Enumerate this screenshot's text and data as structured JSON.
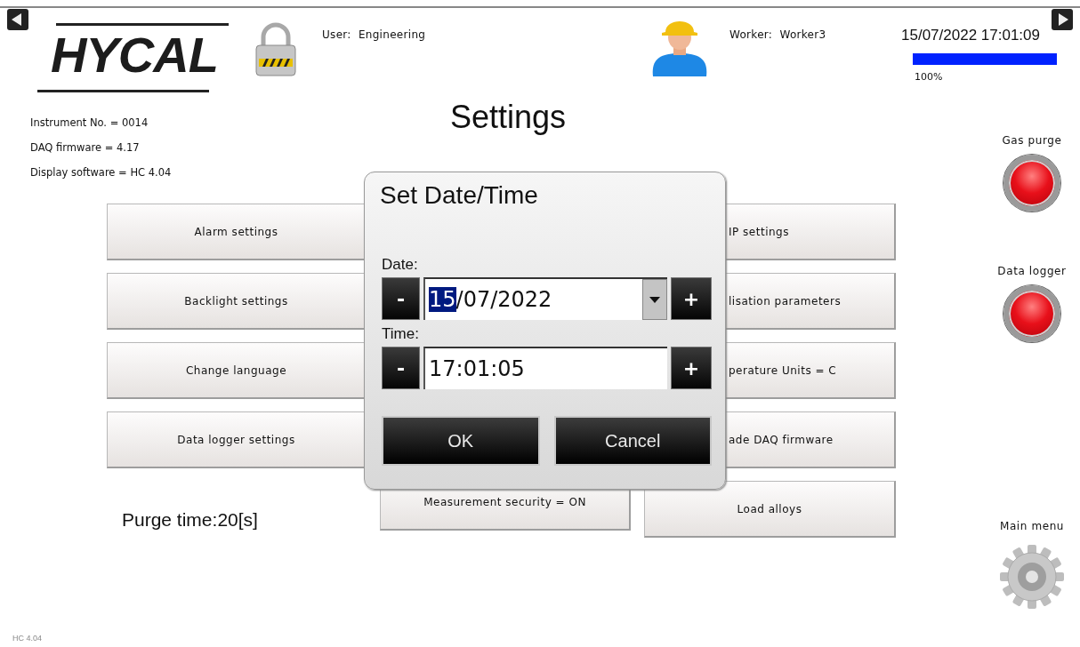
{
  "logo": "HYCAL",
  "user": "User:  Engineering",
  "worker": "Worker:  Worker3",
  "datetime": "15/07/2022 17:01:09",
  "progress": {
    "level": 1,
    "reading": "100%"
  },
  "info": [
    "Instrument No. = 0014",
    "DAQ firmware = 4.17",
    "Display software = HC 4.04"
  ],
  "title": "Settings",
  "button_columns": [
    [
      {
        "label": "Alarm settings",
        "kind": "full"
      },
      {
        "label": "Backlight settings",
        "kind": "full"
      },
      {
        "label": "Change language",
        "kind": "full"
      },
      {
        "label": "Data logger settings",
        "kind": "full"
      }
    ],
    [
      {
        "label": "Measurement security = ON",
        "kind": "full"
      }
    ],
    [
      {
        "label": "IP settings",
        "kind": "covered"
      },
      {
        "label": "lisation parameters",
        "kind": "covered"
      },
      {
        "label": "perature Units = C",
        "kind": "covered"
      },
      {
        "label": "ade DAQ firmware",
        "kind": "covered"
      },
      {
        "label": "Load alloys",
        "kind": "full"
      }
    ]
  ],
  "purge_time": "Purge time:20[s]",
  "indicators": [
    {
      "label": "Gas purge",
      "kind": "lamp",
      "on": false
    },
    {
      "label": "Data logger",
      "kind": "lamp",
      "on": false
    },
    {
      "label": "Main menu",
      "kind": "gear"
    }
  ],
  "dialog": {
    "title": "Set Date/Time",
    "fields": [
      {
        "label": "Date:",
        "kind": "dropdown",
        "minus": "-",
        "plus": "+",
        "segments": [
          {
            "text": "15",
            "selected": true
          },
          {
            "text": "/07/2022",
            "selected": false
          }
        ]
      },
      {
        "label": "Time:",
        "kind": "plain",
        "minus": "-",
        "plus": "+",
        "segments": [
          {
            "text": "17:01:05",
            "selected": false
          }
        ]
      }
    ],
    "buttons": [
      "OK",
      "Cancel"
    ]
  },
  "version": "HC 4.04"
}
